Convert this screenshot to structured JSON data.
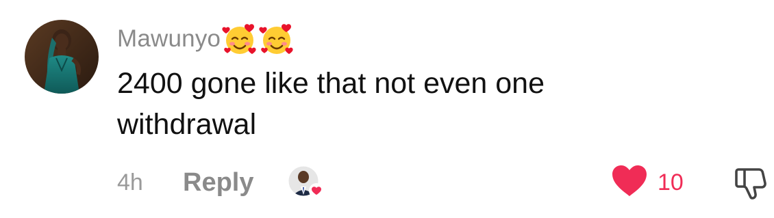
{
  "comment": {
    "username": "Mawunyo",
    "username_emojis": [
      "smiling-face-with-hearts-icon",
      "smiling-face-with-hearts-icon"
    ],
    "text": "2400 gone like that not even one withdrawal",
    "time": "4h",
    "reply_label": "Reply",
    "like_count": "10",
    "liked_by_creator": true,
    "liked": true
  },
  "colors": {
    "like_red": "#f02c56",
    "meta_gray": "#8a8a8a",
    "text": "#111111"
  }
}
